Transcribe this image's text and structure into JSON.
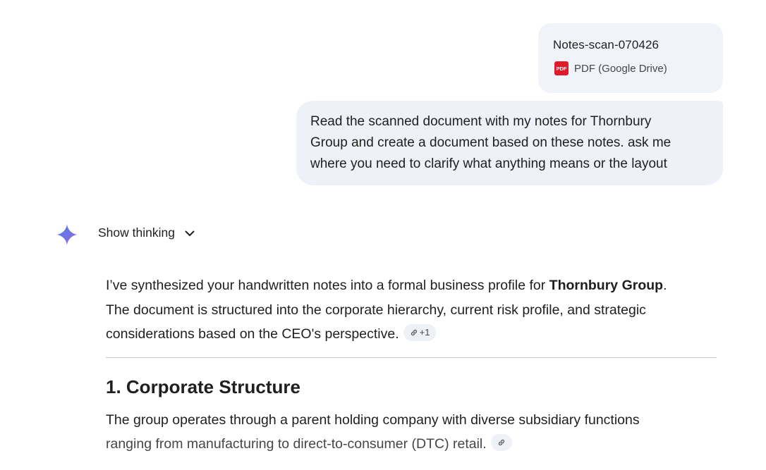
{
  "attachment": {
    "file_name": "Notes-scan-070426",
    "icon_label": "PDF",
    "type_label": "PDF (Google Drive)",
    "icon_color": "#e0192b"
  },
  "user_message": {
    "line1": "Read the scanned document with my notes for Thornbury",
    "line2": "Group and create a document based on these notes. ask me",
    "line3": "where you need to clarify what anything means or the layout"
  },
  "assistant": {
    "show_thinking_label": "Show thinking",
    "intro": {
      "part1": "I’ve synthesized your handwritten notes into a formal business profile for ",
      "bold": "Thornbury Group",
      "part2": ".",
      "line2": "The document is structured into the corporate hierarchy, current risk profile, and strategic",
      "line3": "considerations based on the CEO's perspective.",
      "source_count": "+1"
    },
    "section1": {
      "heading": "1. Corporate Structure",
      "line1": "The group operates through a parent holding company with diverse subsidiary functions",
      "line2": "ranging from manufacturing to direct-to-consumer (DTC) retail."
    }
  },
  "colors": {
    "bubble": "#eef1f8",
    "attachment_card": "#f0f4f9",
    "spark_gradient": [
      "#4285f4",
      "#9b72cb",
      "#d96570"
    ]
  }
}
